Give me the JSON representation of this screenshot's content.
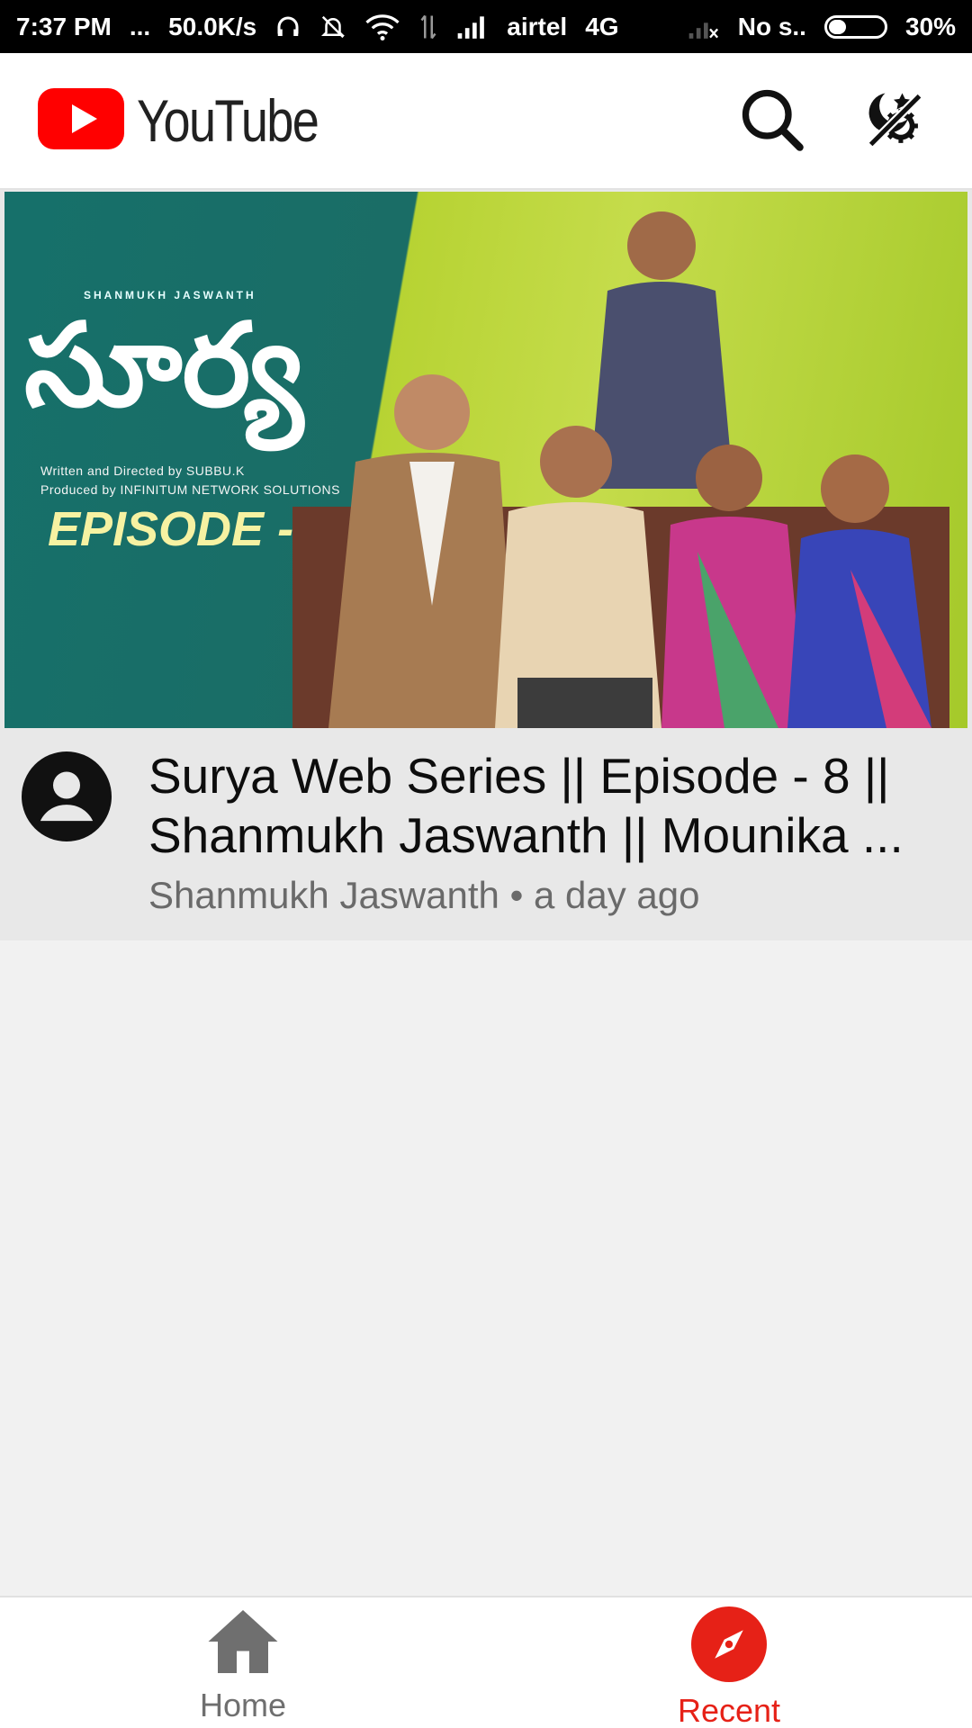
{
  "status_bar": {
    "time": "7:37 PM",
    "dots": "...",
    "net_speed": "50.0K/s",
    "carrier": "airtel",
    "network_type": "4G",
    "sim2": "No s..",
    "battery": "30%",
    "battery_level": 0.3
  },
  "app_bar": {
    "logo_text": "YouTube",
    "brand_color": "#ff0000"
  },
  "video": {
    "thumbnail": {
      "brand": "SHANMUKH JASWANTH",
      "title_telugu": "సూర్య",
      "credit_line1": "Written and Directed by SUBBU.K",
      "credit_line2": "Produced by INFINITUM NETWORK SOLUTIONS",
      "episode": "EPISODE - 8"
    },
    "title": "Surya Web Series || Episode - 8 || Shanmukh Jaswanth || Mounika ...",
    "channel": "Shanmukh Jaswanth",
    "separator": "•",
    "age": "a day ago"
  },
  "bottom_nav": {
    "items": [
      {
        "label": "Home",
        "icon": "home-icon",
        "active": false
      },
      {
        "label": "Recent",
        "icon": "compass-icon",
        "active": true
      }
    ],
    "active_color": "#e62117",
    "inactive_color": "#6f6f6f"
  }
}
